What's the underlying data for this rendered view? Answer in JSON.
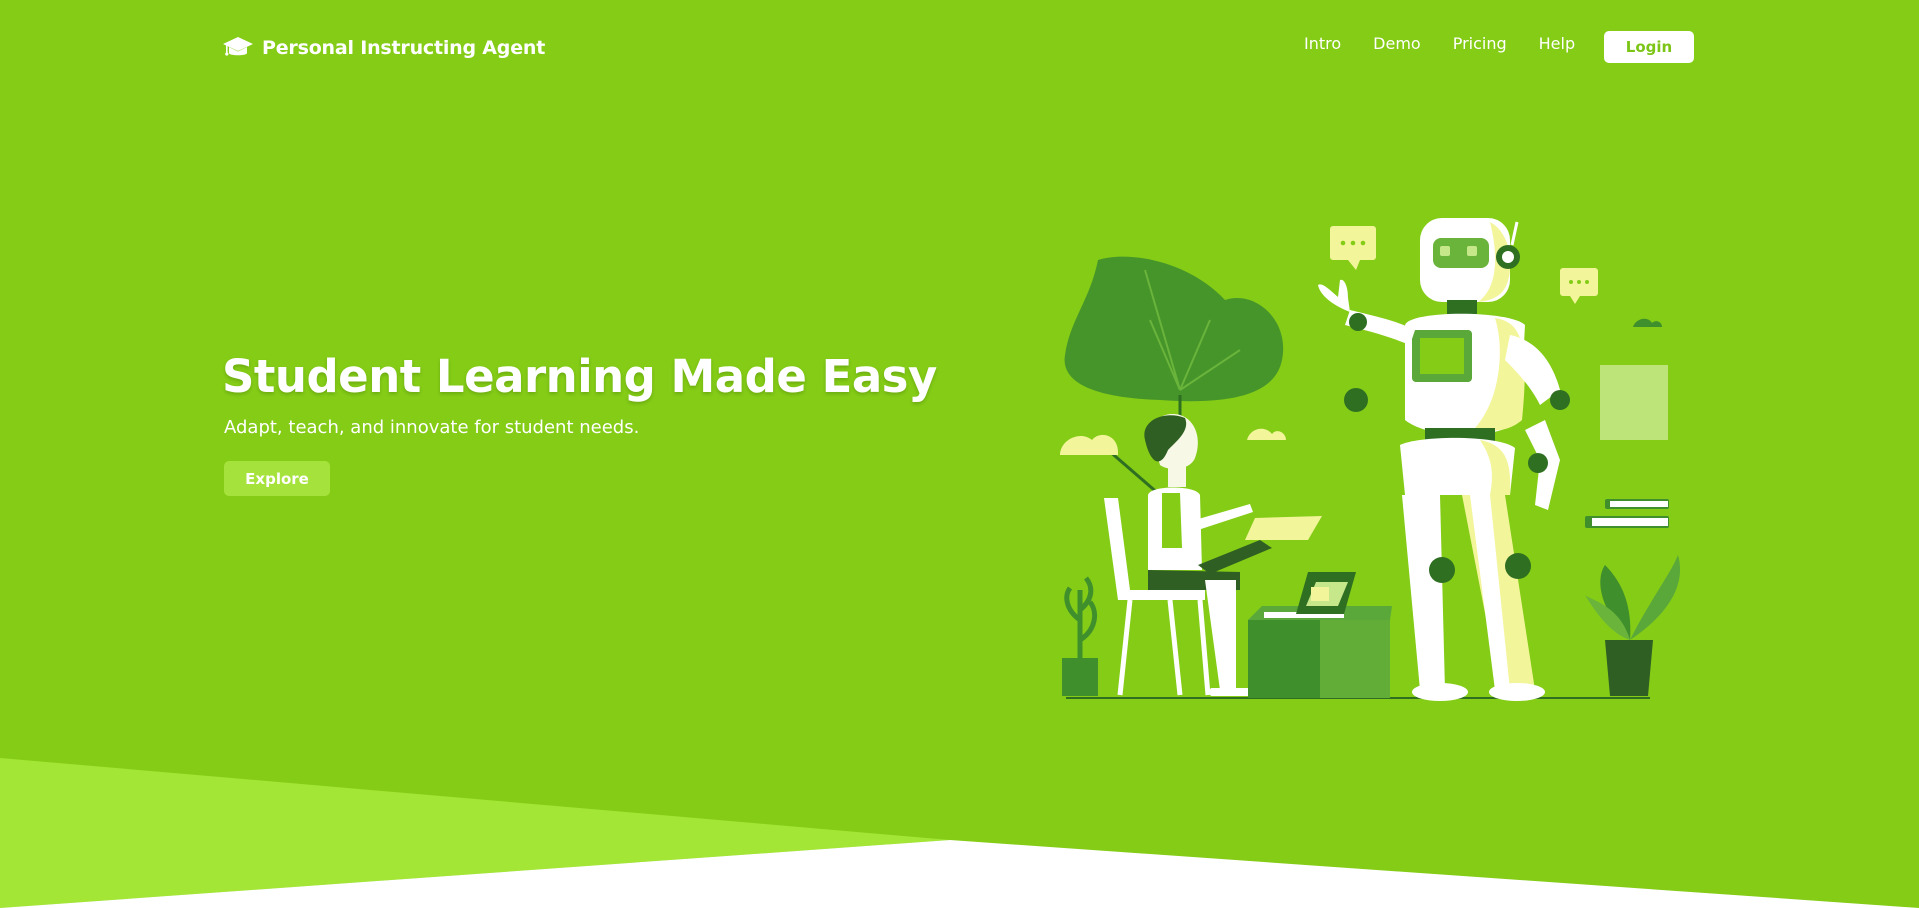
{
  "brand": {
    "name": "Personal Instructing Agent",
    "icon": "graduation-cap-icon"
  },
  "nav": {
    "links": [
      "Intro",
      "Demo",
      "Pricing",
      "Help"
    ],
    "login_label": "Login"
  },
  "hero": {
    "title": "Student Learning Made Easy",
    "subtitle": "Adapt, teach, and innovate for student needs.",
    "cta_label": "Explore",
    "illustration": "student-with-robot-tutor-illustration"
  },
  "colors": {
    "primary": "#84cc16",
    "accent_light": "#a3e635",
    "dark_green": "#3f8f2c",
    "pale_yellow": "#f3f59b",
    "white": "#ffffff"
  }
}
